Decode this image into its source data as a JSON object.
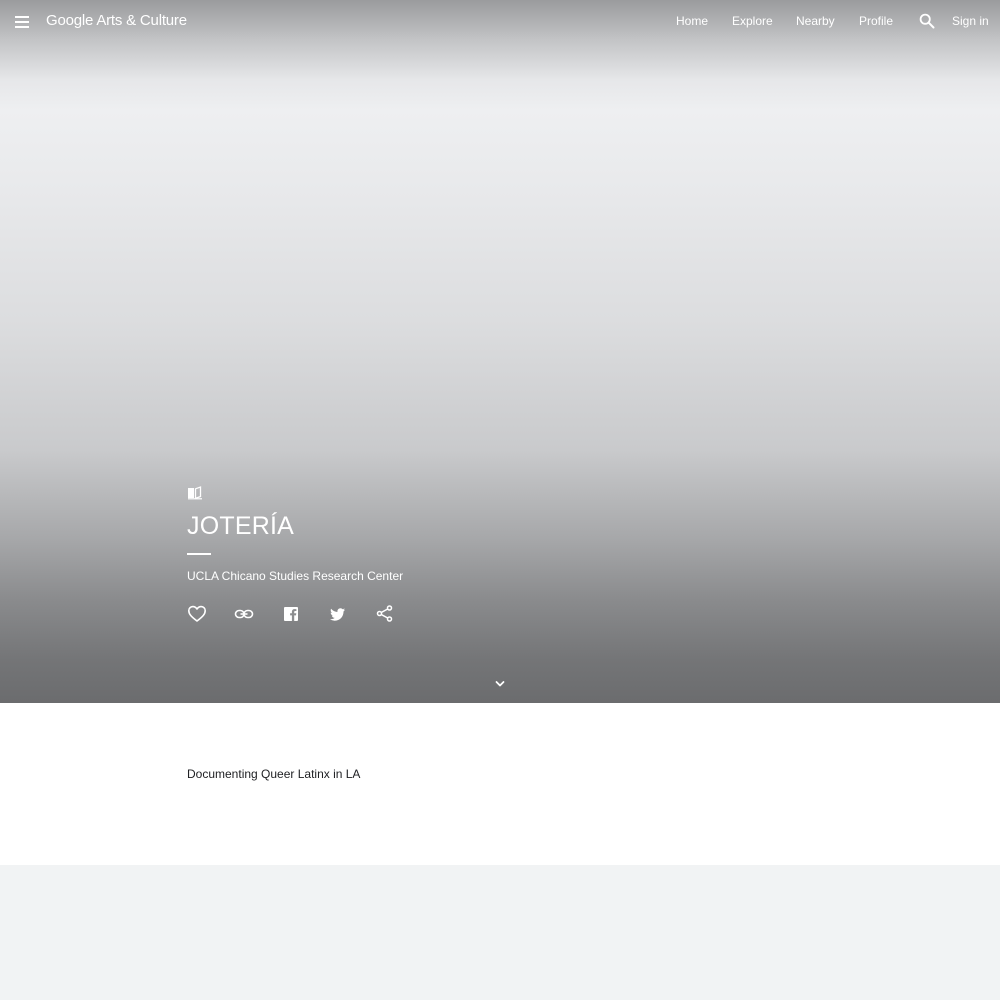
{
  "header": {
    "logo_brand": "Google",
    "logo_product": "Arts & Culture",
    "nav": {
      "home": "Home",
      "explore": "Explore",
      "nearby": "Nearby",
      "profile": "Profile",
      "sign_in": "Sign in"
    }
  },
  "hero": {
    "title": "JOTERÍA",
    "subtitle": "UCLA Chicano Studies Research Center",
    "story_icon": "book-open-icon",
    "actions": [
      "heart-icon",
      "link-icon",
      "facebook-icon",
      "twitter-icon",
      "share-icon"
    ]
  },
  "content": {
    "description": "Documenting Queer Latinx in LA"
  },
  "colors": {
    "hero_bottom": "#6b6c6e",
    "hero_top": "#9a9b9d",
    "text_dark": "#202124",
    "page_background": "#f1f3f4"
  }
}
